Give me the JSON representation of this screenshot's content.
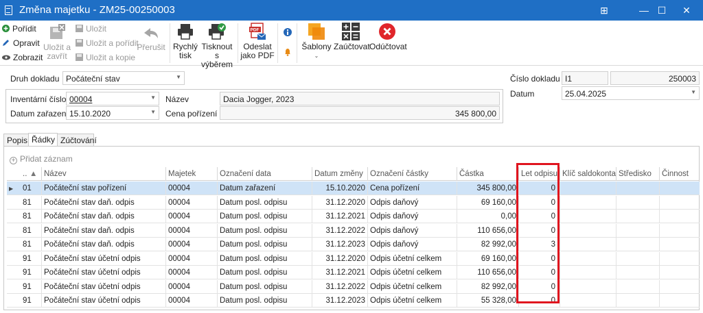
{
  "window": {
    "title": "Změna majetku - ZM25-00250003",
    "controls": [
      "⊞",
      "—",
      "☐",
      "✕"
    ]
  },
  "toolbar": {
    "create": "Pořídit",
    "edit": "Opravit",
    "view": "Zobrazit",
    "save_close": [
      "Uložit a",
      "zavřít"
    ],
    "save": "Uložit",
    "save_create": "Uložit a pořídit",
    "save_copy": "Uložit a kopie",
    "cancel": "Přerušit",
    "quick_print": [
      "Rychlý",
      "tisk"
    ],
    "print_sel": [
      "Tisknout",
      "s výběrem"
    ],
    "send_pdf": [
      "Odeslat",
      "jako PDF"
    ],
    "templates": "Šablony",
    "post": "Zaúčtovat",
    "unpost": "Odúčtovat"
  },
  "form": {
    "doc_type_label": "Druh dokladu",
    "doc_type_value": "Počáteční stav",
    "inv_no_label": "Inventární číslo",
    "inv_no_value": "00004",
    "name_label": "Název",
    "name_value": "Dacia Jogger, 2023",
    "date_label": "Datum zařazení",
    "date_value": "15.10.2020",
    "price_label": "Cena pořízení",
    "price_value": "345 800,00",
    "doc_no_label": "Číslo dokladu",
    "doc_no_prefix": "I1",
    "doc_no_value": "250003",
    "doc_date_label": "Datum",
    "doc_date_value": "25.04.2025"
  },
  "tabs": [
    "Popis",
    "Řádky",
    "Zúčtování"
  ],
  "grid": {
    "add_record": "Přidat záznam",
    "headers": {
      "code": "...",
      "name": "Název",
      "asset": "Majetek",
      "date_type": "Označení data",
      "change_date": "Datum změny",
      "amount_type": "Označení částky",
      "amount": "Částka",
      "years": "Let odpisu",
      "key": "Klíč saldokonta",
      "center": "Středisko",
      "activity": "Činnost"
    },
    "rows": [
      {
        "code": "01",
        "name": "Počáteční stav pořízení",
        "asset": "00004",
        "date_type": "Datum zařazení",
        "change_date": "15.10.2020",
        "amount_type": "Cena pořízení",
        "amount": "345 800,00",
        "years": "0"
      },
      {
        "code": "81",
        "name": "Počáteční stav daň. odpis",
        "asset": "00004",
        "date_type": "Datum posl. odpisu",
        "change_date": "31.12.2020",
        "amount_type": "Odpis daňový",
        "amount": "69 160,00",
        "years": "0"
      },
      {
        "code": "81",
        "name": "Počáteční stav daň. odpis",
        "asset": "00004",
        "date_type": "Datum posl. odpisu",
        "change_date": "31.12.2021",
        "amount_type": "Odpis daňový",
        "amount": "0,00",
        "years": "0"
      },
      {
        "code": "81",
        "name": "Počáteční stav daň. odpis",
        "asset": "00004",
        "date_type": "Datum posl. odpisu",
        "change_date": "31.12.2022",
        "amount_type": "Odpis daňový",
        "amount": "110 656,00",
        "years": "0"
      },
      {
        "code": "81",
        "name": "Počáteční stav daň. odpis",
        "asset": "00004",
        "date_type": "Datum posl. odpisu",
        "change_date": "31.12.2023",
        "amount_type": "Odpis daňový",
        "amount": "82 992,00",
        "years": "3"
      },
      {
        "code": "91",
        "name": "Počáteční stav účetní odpis",
        "asset": "00004",
        "date_type": "Datum posl. odpisu",
        "change_date": "31.12.2020",
        "amount_type": "Odpis účetní celkem",
        "amount": "69 160,00",
        "years": "0"
      },
      {
        "code": "91",
        "name": "Počáteční stav účetní odpis",
        "asset": "00004",
        "date_type": "Datum posl. odpisu",
        "change_date": "31.12.2021",
        "amount_type": "Odpis účetní celkem",
        "amount": "110 656,00",
        "years": "0"
      },
      {
        "code": "91",
        "name": "Počáteční stav účetní odpis",
        "asset": "00004",
        "date_type": "Datum posl. odpisu",
        "change_date": "31.12.2022",
        "amount_type": "Odpis účetní celkem",
        "amount": "82 992,00",
        "years": "0"
      },
      {
        "code": "91",
        "name": "Počáteční stav účetní odpis",
        "asset": "00004",
        "date_type": "Datum posl. odpisu",
        "change_date": "31.12.2023",
        "amount_type": "Odpis účetní celkem",
        "amount": "55 328,00",
        "years": "0"
      }
    ]
  },
  "colors": {
    "titlebar": "#1f6fc5",
    "selected_row": "#cfe3f7",
    "highlight": "#e0141e"
  }
}
